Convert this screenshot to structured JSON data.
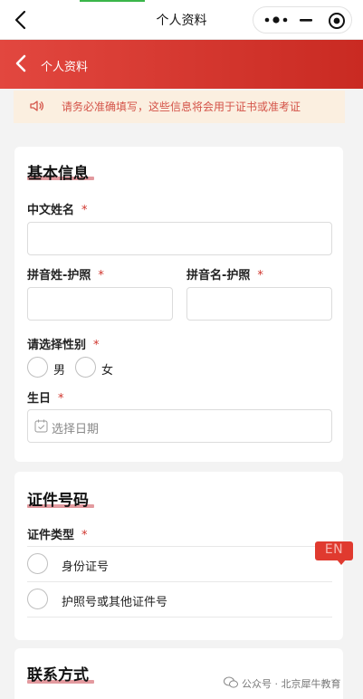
{
  "navbar": {
    "title": "个人资料"
  },
  "header": {
    "title": "个人资料"
  },
  "notice": {
    "text": "请务必准确填写，这些信息将会用于证书或准考证"
  },
  "basic": {
    "section_title": "基本信息",
    "chinese_name_label": "中文姓名",
    "surname_label": "拼音姓-护照",
    "given_name_label": "拼音名-护照",
    "gender_label": "请选择性别",
    "gender_options": [
      "男",
      "女"
    ],
    "birthday_label": "生日",
    "birthday_placeholder": "选择日期"
  },
  "id_section": {
    "section_title": "证件号码",
    "type_label": "证件类型",
    "options": [
      "身份证号",
      "护照号或其他证件号"
    ]
  },
  "contact": {
    "section_title": "联系方式"
  },
  "required_mark": "*",
  "language_badge": "EN",
  "watermark": "公众号 · 北京犀牛教育",
  "colors": {
    "accent": "#d0342c",
    "header_start": "#e2473f",
    "header_end": "#c92a22",
    "notice_bg": "#fbefe0"
  }
}
